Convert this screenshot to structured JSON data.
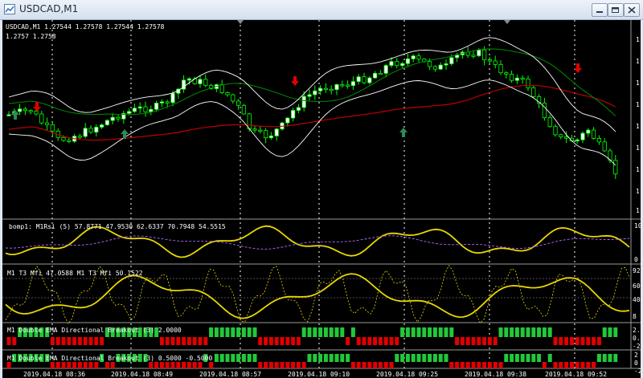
{
  "window": {
    "title": "USDCAD,M1",
    "buttons": [
      "minimize",
      "restore",
      "close"
    ]
  },
  "main_panel": {
    "header": "USDCAD,M1  1.27544 1.27578 1.27544 1.27578",
    "subheader": "1.2757    1.2758",
    "right_ticks": [
      "1",
      "1",
      "1",
      "1",
      "1",
      "1",
      "1",
      "1",
      "1"
    ]
  },
  "panels": [
    {
      "id": "bomp",
      "header": "bomp1: M1Rsi (5) 57.8771 47.9530 62.6337 70.7948 54.5515",
      "right_ticks": [
        "10",
        "0"
      ]
    },
    {
      "id": "mfi",
      "header": "M1  T3 Mfi  47.0588  M1  T3 Mfi  50.1522",
      "right_ticks": [
        "92",
        "60",
        "40",
        "8"
      ]
    },
    {
      "id": "ema1",
      "header": "M1 Double EMA Directional Breakout (3) 2.0000",
      "right_ticks": [
        "2.",
        "0.",
        "-2"
      ]
    },
    {
      "id": "ema2",
      "header": "M1 Double EMA Directional Breakout (3) 0.5000 -0.5000",
      "right_ticks": [
        "2",
        "0",
        "-2"
      ]
    }
  ],
  "time_axis": {
    "labels": [
      "2019.04.18 08:36",
      "2019.04.18 08:49",
      "2019.04.18 08:57",
      "2019.04.18 09:10",
      "2019.04.18 09:25",
      "2019.04.18 09:38",
      "2019.04.18 09:52"
    ]
  },
  "colors": {
    "bull": "#ffffff",
    "bear": "#000000",
    "candle_outline": "#00ff00",
    "bb_band": "#ffffff",
    "ma_green": "#008000",
    "ma_red": "#c00000",
    "arrow_up": "#2e8b57",
    "arrow_down": "#e00000",
    "rsi_line": "#e8d800",
    "signal_dash": "#b06cff",
    "bar_green": "#22c83a",
    "bar_red": "#e00000"
  }
}
